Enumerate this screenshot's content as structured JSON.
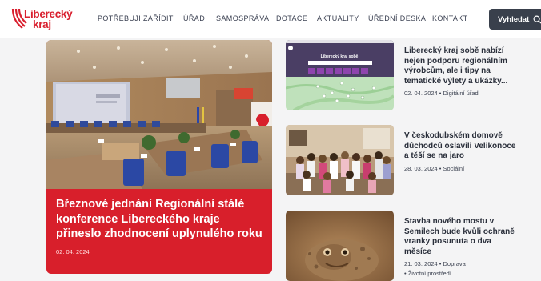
{
  "logo": {
    "line1": "Liberecký",
    "line2": "kraj"
  },
  "nav": [
    {
      "label": "POTŘEBUJI ZAŘÍDIT"
    },
    {
      "label": "ÚŘAD"
    },
    {
      "label": "SAMOSPRÁVA"
    },
    {
      "label": "DOTACE"
    },
    {
      "label": "AKTUALITY"
    },
    {
      "label": "ÚŘEDNÍ DESKA"
    },
    {
      "label": "KONTAKT"
    }
  ],
  "search": {
    "label": "Vyhledat",
    "icon": "search-icon"
  },
  "hero": {
    "title": "Březnové jednání Regionální stálé konference Libereckého kraje přineslo zhodnocení uplynulého roku",
    "date": "02. 04. 2024"
  },
  "articles": [
    {
      "title": "Liberecký kraj sobě nabízí nejen podporu regionálním výrobcům, ale i tipy na tematické výlety a ukázky...",
      "meta": "02. 04. 2024 • Digitální úřad",
      "screenshot_title": "Liberecký kraj sobě"
    },
    {
      "title": "V českodubském domově důchodců oslavili Velikonoce a těší se na jaro",
      "meta": "28. 03. 2024 • Sociální"
    },
    {
      "title": "Stavba nového mostu v Semilech bude kvůli ochraně vranky posunuta o dva měsíce",
      "meta_line1": "21. 03. 2024 • Doprava",
      "meta_line2": "• Životní prostředí"
    }
  ],
  "colors": {
    "brand_red": "#d81f2b",
    "search_bg": "#39404c",
    "map_green": "#b4dbb0"
  }
}
